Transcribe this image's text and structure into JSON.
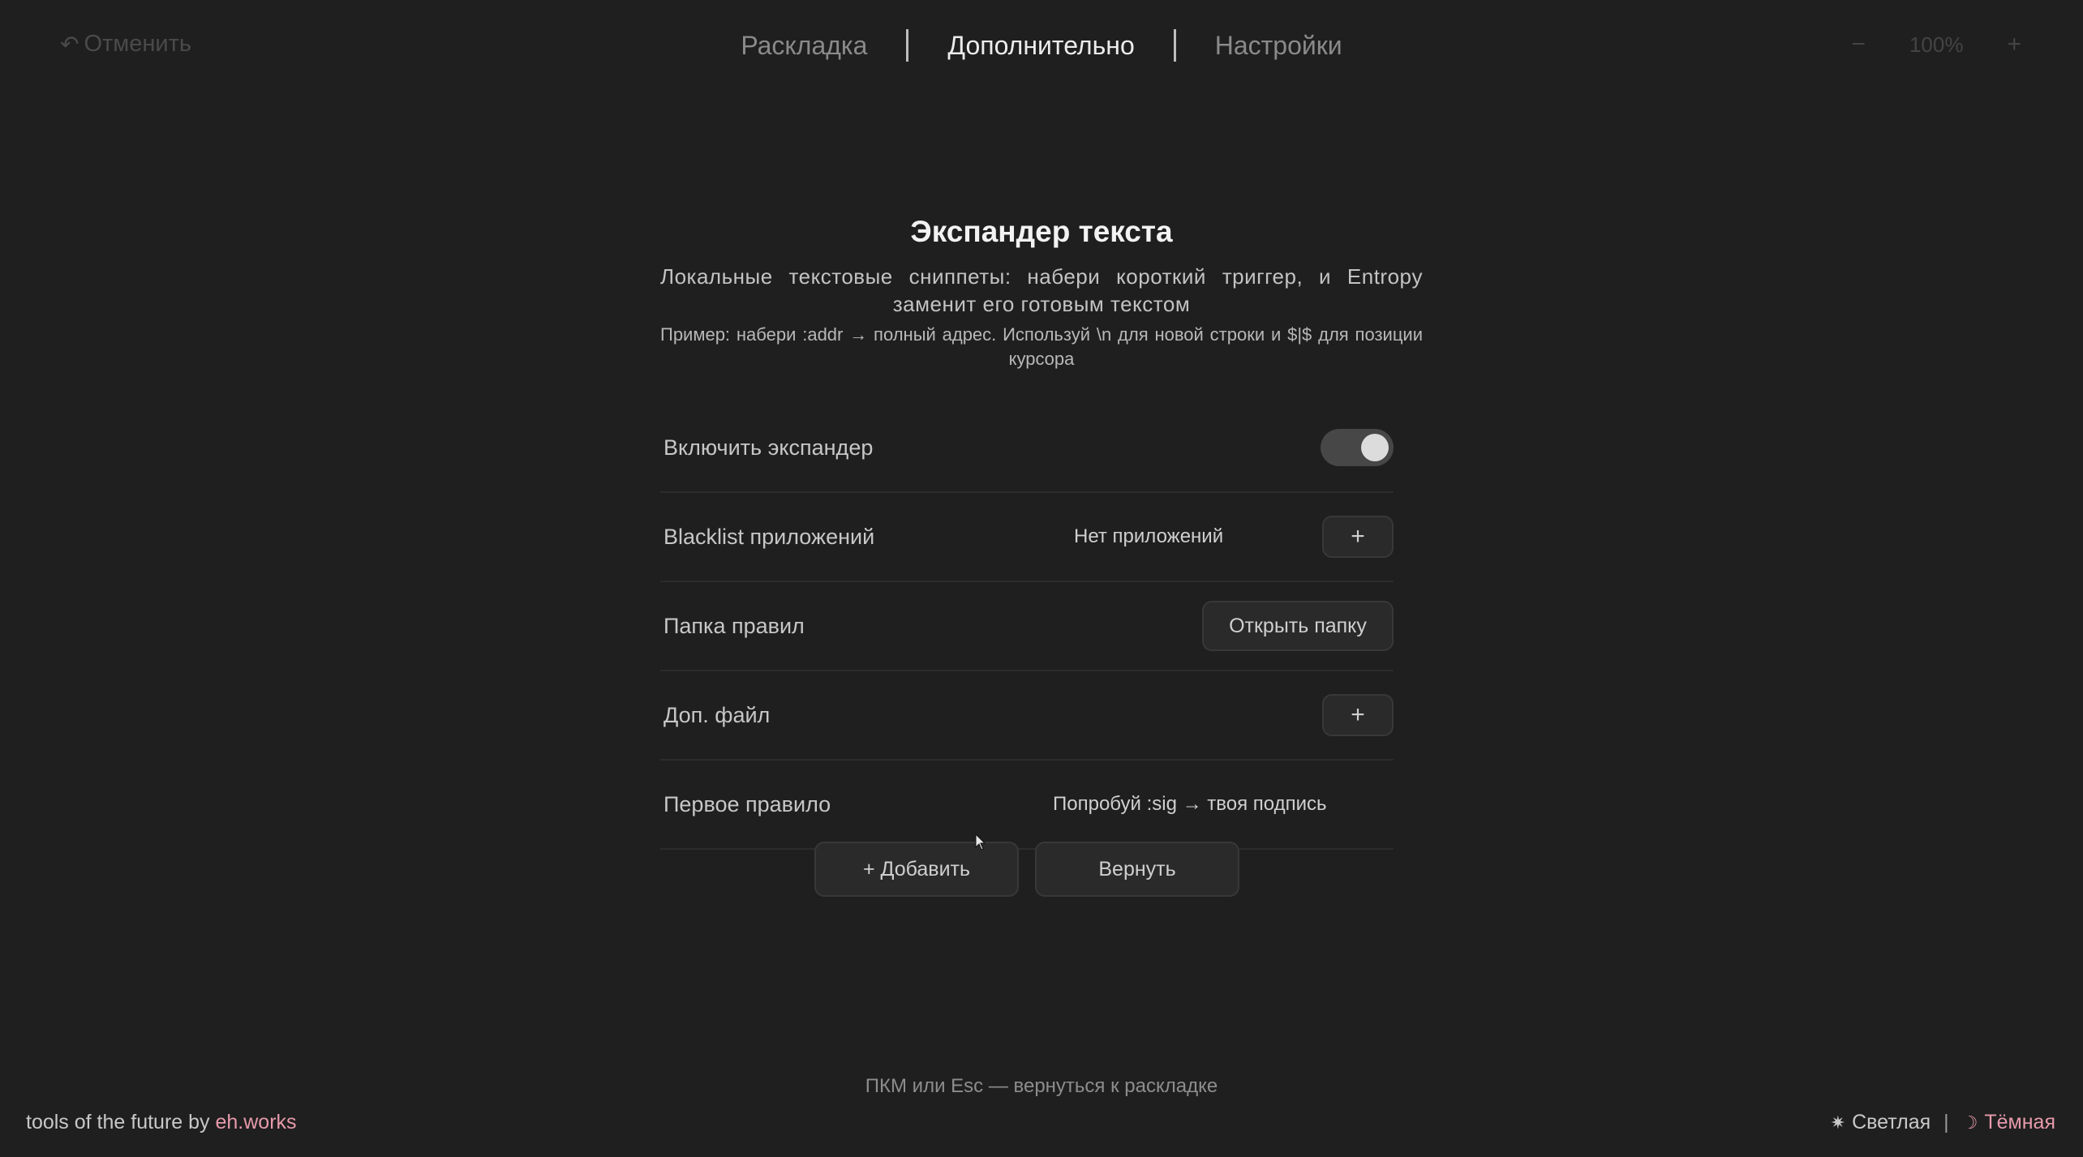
{
  "header": {
    "undo_label": "Отменить",
    "undo_icon": "undo-arrow-icon",
    "tabs": [
      {
        "label": "Раскладка",
        "active": false
      },
      {
        "label": "Дополнительно",
        "active": true
      },
      {
        "label": "Настройки",
        "active": false
      }
    ],
    "zoom": {
      "minus": "−",
      "level": "100%",
      "plus": "+"
    }
  },
  "panel": {
    "title": "Экспандер текста",
    "subtitle": "Локальные текстовые сниппеты: набери короткий триггер, и Entropy заменит его готовым текстом",
    "example": "Пример: набери :addr → полный адрес. Используй \\n для новой строки и $|$ для позиции курсора",
    "rows": {
      "enable": {
        "label": "Включить экспандер",
        "toggle_on": true
      },
      "blacklist": {
        "label": "Blacklist приложений",
        "value": "Нет приложений",
        "add_label": "+"
      },
      "folder": {
        "label": "Папка правил",
        "button_label": "Открыть папку"
      },
      "extra_file": {
        "label": "Доп. файл",
        "add_label": "+"
      },
      "first_rule": {
        "label": "Первое правило",
        "value": "Попробуй :sig → твоя подпись"
      }
    },
    "actions": {
      "add_label": "+ Добавить",
      "revert_label": "Вернуть"
    }
  },
  "footer": {
    "hint": "ПКМ или Esc — вернуться к раскладке",
    "brand_prefix": "tools of the future by ",
    "brand_link": "eh.works",
    "theme": {
      "light_icon": "✷",
      "light_label": "Светлая",
      "separator": "|",
      "dark_icon": "☽",
      "dark_label": "Тёмная",
      "active": "dark"
    }
  },
  "colors": {
    "background": "#1f1f1f",
    "accent": "#e79aab",
    "text": "#cfcfcf"
  }
}
